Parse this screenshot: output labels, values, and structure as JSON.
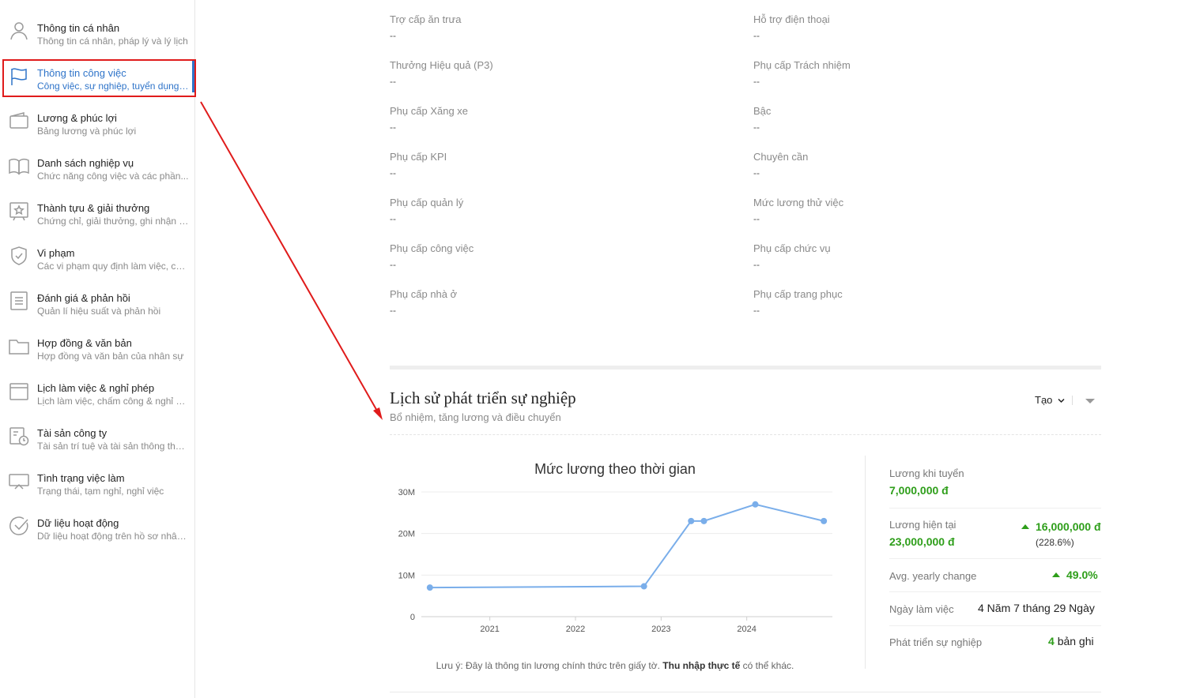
{
  "sidebar": {
    "items": [
      {
        "title": "Thông tin cá nhân",
        "subtitle": "Thông tin cá nhân, pháp lý và lý lịch",
        "icon": "person-icon"
      },
      {
        "title": "Thông tin công việc",
        "subtitle": "Công việc, sự nghiệp, tuyển dụng ...",
        "icon": "flag-icon",
        "active": true
      },
      {
        "title": "Lương & phúc lợi",
        "subtitle": "Bảng lương và phúc lợi",
        "icon": "wallet-icon"
      },
      {
        "title": "Danh sách nghiệp vụ",
        "subtitle": "Chức năng công việc và các phần...",
        "icon": "book-icon"
      },
      {
        "title": "Thành tựu & giải thưởng",
        "subtitle": "Chứng chỉ, giải thưởng, ghi nhận v...",
        "icon": "award-icon"
      },
      {
        "title": "Vi phạm",
        "subtitle": "Các vi phạm quy định làm việc, ch...",
        "icon": "shield-icon"
      },
      {
        "title": "Đánh giá & phản hồi",
        "subtitle": "Quản lí hiệu suất và phản hồi",
        "icon": "document-icon"
      },
      {
        "title": "Hợp đồng & văn bản",
        "subtitle": "Hợp đồng và văn bản của nhân sự",
        "icon": "folder-icon"
      },
      {
        "title": "Lịch làm việc & nghỉ phép",
        "subtitle": "Lịch làm việc, chấm công & nghỉ p...",
        "icon": "calendar-icon"
      },
      {
        "title": "Tài sản công ty",
        "subtitle": "Tài sản trí tuệ và tài sản thông thư...",
        "icon": "asset-clock-icon"
      },
      {
        "title": "Tình trạng việc làm",
        "subtitle": "Trạng thái, tạm nghỉ, nghỉ việc",
        "icon": "monitor-icon"
      },
      {
        "title": "Dữ liệu hoạt động",
        "subtitle": "Dữ liệu hoạt động trên hồ sơ nhân...",
        "icon": "check-circle-icon"
      }
    ]
  },
  "fields": {
    "left": [
      {
        "label": "Trợ cấp ăn trưa",
        "value": "--"
      },
      {
        "label": "Thưởng Hiệu quả (P3)",
        "value": "--"
      },
      {
        "label": "Phụ cấp Xăng xe",
        "value": "--"
      },
      {
        "label": "Phụ cấp KPI",
        "value": "--"
      },
      {
        "label": "Phụ cấp quản lý",
        "value": "--"
      },
      {
        "label": "Phụ cấp công việc",
        "value": "--"
      },
      {
        "label": "Phụ cấp nhà ở",
        "value": "--"
      }
    ],
    "right": [
      {
        "label": "Hỗ trợ điện thoại",
        "value": "--"
      },
      {
        "label": "Phụ cấp Trách nhiệm",
        "value": "--"
      },
      {
        "label": "Bậc",
        "value": "--"
      },
      {
        "label": "Chuyên cần",
        "value": "--"
      },
      {
        "label": "Mức lương thử việc",
        "value": "--"
      },
      {
        "label": "Phụ cấp chức vụ",
        "value": "--"
      },
      {
        "label": "Phụ cấp trang phục",
        "value": "--"
      }
    ]
  },
  "career": {
    "title": "Lịch sử phát triển sự nghiệp",
    "subtitle": "Bổ nhiệm, tăng lương và điều chuyển",
    "create_label": "Tạo",
    "note_prefix": "Lưu ý: Đây là thông tin lương chính thức trên giấy tờ.",
    "note_bold": "Thu nhập thực tế",
    "note_suffix": "có thể khác."
  },
  "stats": {
    "start_salary_label": "Lương khi tuyển",
    "start_salary_value": "7,000,000 đ",
    "current_salary_label": "Lương hiện tại",
    "current_salary_value": "23,000,000 đ",
    "current_change_value": "16,000,000 đ",
    "current_change_pct": "(228.6%)",
    "avg_change_label": "Avg. yearly change",
    "avg_change_value": "49.0%",
    "workdays_label": "Ngày làm việc",
    "workdays_value": "4 Năm 7 tháng 29 Ngày",
    "career_label": "Phát triển sự nghiệp",
    "career_count": "4",
    "career_unit": "bản ghi"
  },
  "chart_data": {
    "type": "line",
    "title": "Mức lương theo thời gian",
    "xlabel": "",
    "ylabel": "",
    "x_ticks": [
      "2021",
      "2022",
      "2023",
      "2024"
    ],
    "y_ticks": [
      "0",
      "10M",
      "20M",
      "30M"
    ],
    "ylim": [
      0,
      30000000
    ],
    "xlim": [
      2020.2,
      2025.0
    ],
    "grid": true,
    "series": [
      {
        "color": "#7aaeea",
        "points": [
          {
            "x": 2020.3,
            "y": 7000000
          },
          {
            "x": 2022.8,
            "y": 7300000
          },
          {
            "x": 2023.35,
            "y": 23000000
          },
          {
            "x": 2023.5,
            "y": 23000000
          },
          {
            "x": 2024.1,
            "y": 27000000
          },
          {
            "x": 2024.9,
            "y": 23000000
          }
        ]
      }
    ]
  },
  "annotation": {
    "color": "#e01b1b"
  }
}
